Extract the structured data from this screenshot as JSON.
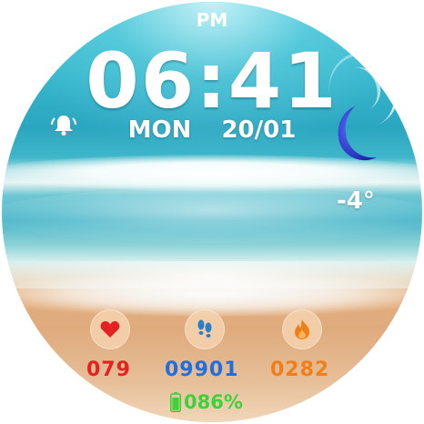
{
  "watch": {
    "ampm": "PM",
    "time": "06:41",
    "day": "MON",
    "date": "20/01",
    "temperature": "-4°",
    "weather_icon": "moon-icon",
    "alarm_icon": "alarm-bell-icon"
  },
  "stats": {
    "heart_rate": "079",
    "steps": "09901",
    "calories": "0282"
  },
  "battery": {
    "text": "086%",
    "level": 0.86
  },
  "colors": {
    "heart": "#e52222",
    "steps": "#1f6fe0",
    "calories": "#f07f1a",
    "battery": "#3fd13c",
    "moon": "#2a3bd6"
  }
}
